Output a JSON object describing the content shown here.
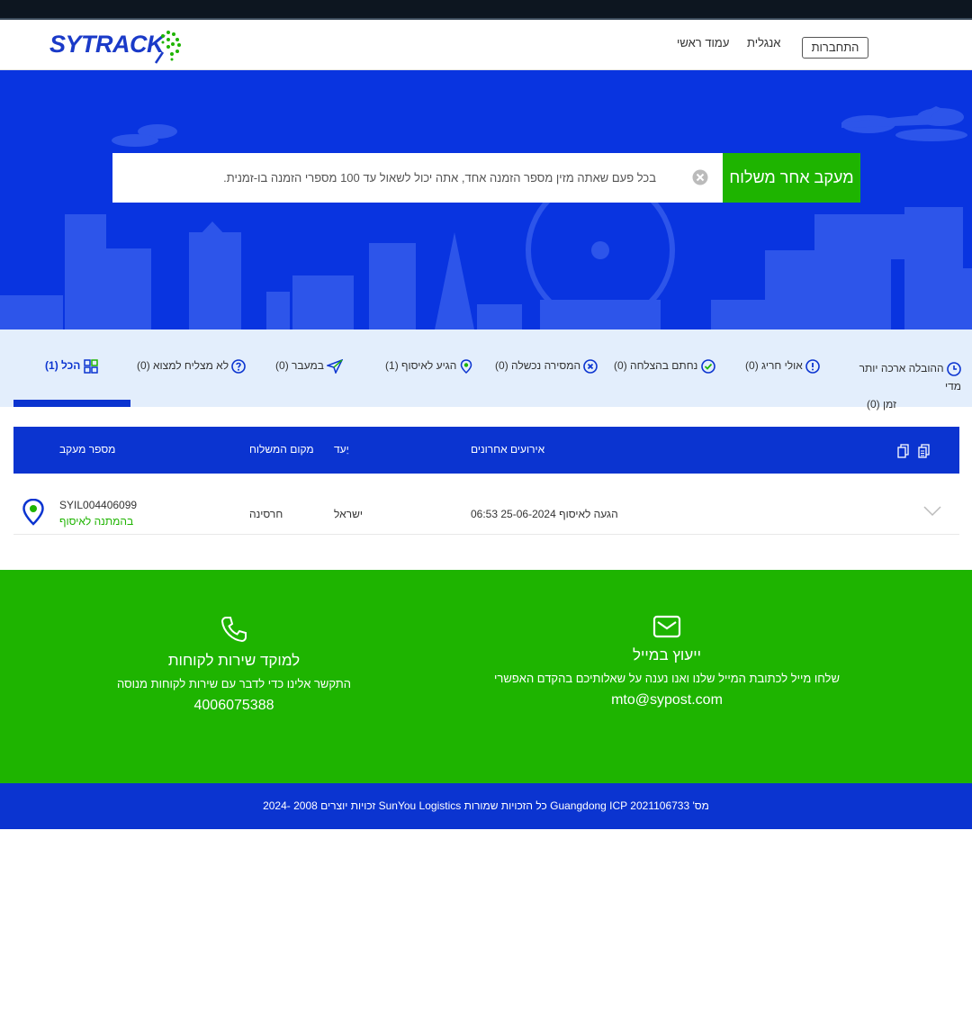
{
  "header": {
    "logo": "SYTRACK",
    "nav_home": "עמוד ראשי",
    "nav_english": "אנגלית",
    "login": "התחברות"
  },
  "search": {
    "placeholder": "בכל פעם שאתה מזין מספר הזמנה אחד, אתה יכול לשאול עד 100 מספרי הזמנה בו-זמנית.",
    "button": "מעקב אחר משלוח"
  },
  "tabs": [
    {
      "label": "ההובלה ארכה יותר מדי",
      "label2": "זמן (0)",
      "icon": "clock-icon"
    },
    {
      "label": "אולי חריג (0)",
      "icon": "exclamation-icon"
    },
    {
      "label": "נחתם בהצלחה (0)",
      "icon": "check-circle-icon"
    },
    {
      "label": "המסירה נכשלה (0)",
      "icon": "x-circle-icon"
    },
    {
      "label": "הגיע לאיסוף (1)",
      "icon": "location-pin-icon"
    },
    {
      "label": "במעבר (0)",
      "icon": "send-arrow-icon"
    },
    {
      "label": "לא מצליח למצוא (0)",
      "icon": "question-icon"
    },
    {
      "label": "הכל (1)",
      "icon": "grid-icon",
      "active": true
    }
  ],
  "table": {
    "headers": {
      "tracking": "מספר מעקב",
      "origin": "מקום המשלוח",
      "dest": "יַעד",
      "events": "אירועים אחרונים"
    },
    "rows": [
      {
        "tracking": "SYIL004406099",
        "status": "בהמתנה לאיסוף",
        "origin": "חרסינה",
        "dest": "ישראל",
        "event": "הגעה לאיסוף 25-06-2024 06:53"
      }
    ]
  },
  "contact": {
    "email_title": "ייעוץ במייל",
    "email_desc": "שלחו מייל לכתובת המייל שלנו ואנו נענה על שאלותיכם בהקדם האפשרי",
    "email_value": "mto@sypost.com",
    "phone_title": "למוקד שירות לקוחות",
    "phone_desc": "התקשר אלינו כדי לדבר עם שירות לקוחות מנוסה",
    "phone_value": "4006075388"
  },
  "footer": {
    "text": "מס' Guangdong ICP 2021106733 כל הזכויות שמורות SunYou Logistics זכויות יוצרים 2008 -2024"
  },
  "colors": {
    "brand_blue": "#0b34d0",
    "hero_blue": "#0934e0",
    "brand_green": "#1eb400",
    "tabs_bg": "#e3eefc"
  }
}
